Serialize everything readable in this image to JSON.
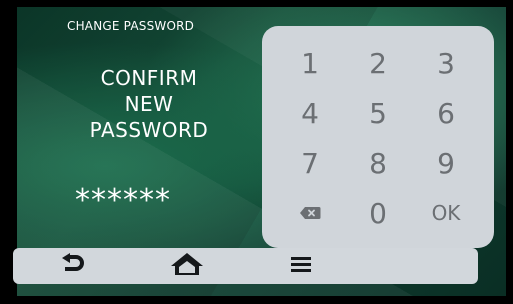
{
  "screen": {
    "title": "CHANGE PASSWORD",
    "prompt_line1": "CONFIRM",
    "prompt_line2": "NEW",
    "prompt_line3": "PASSWORD",
    "masked_password": "******"
  },
  "keypad": {
    "keys": [
      "1",
      "2",
      "3",
      "4",
      "5",
      "6",
      "7",
      "8",
      "9",
      "0"
    ],
    "ok_label": "OK",
    "backspace_icon": "backspace-icon"
  },
  "navbar": {
    "back_icon": "back-icon",
    "home_icon": "home-icon",
    "menu_icon": "menu-icon"
  },
  "colors": {
    "keypad_bg": "#d0d5da",
    "keypad_text": "#6b6f73",
    "screen_bg": "#16513c",
    "nav_icons": "#15181b"
  }
}
